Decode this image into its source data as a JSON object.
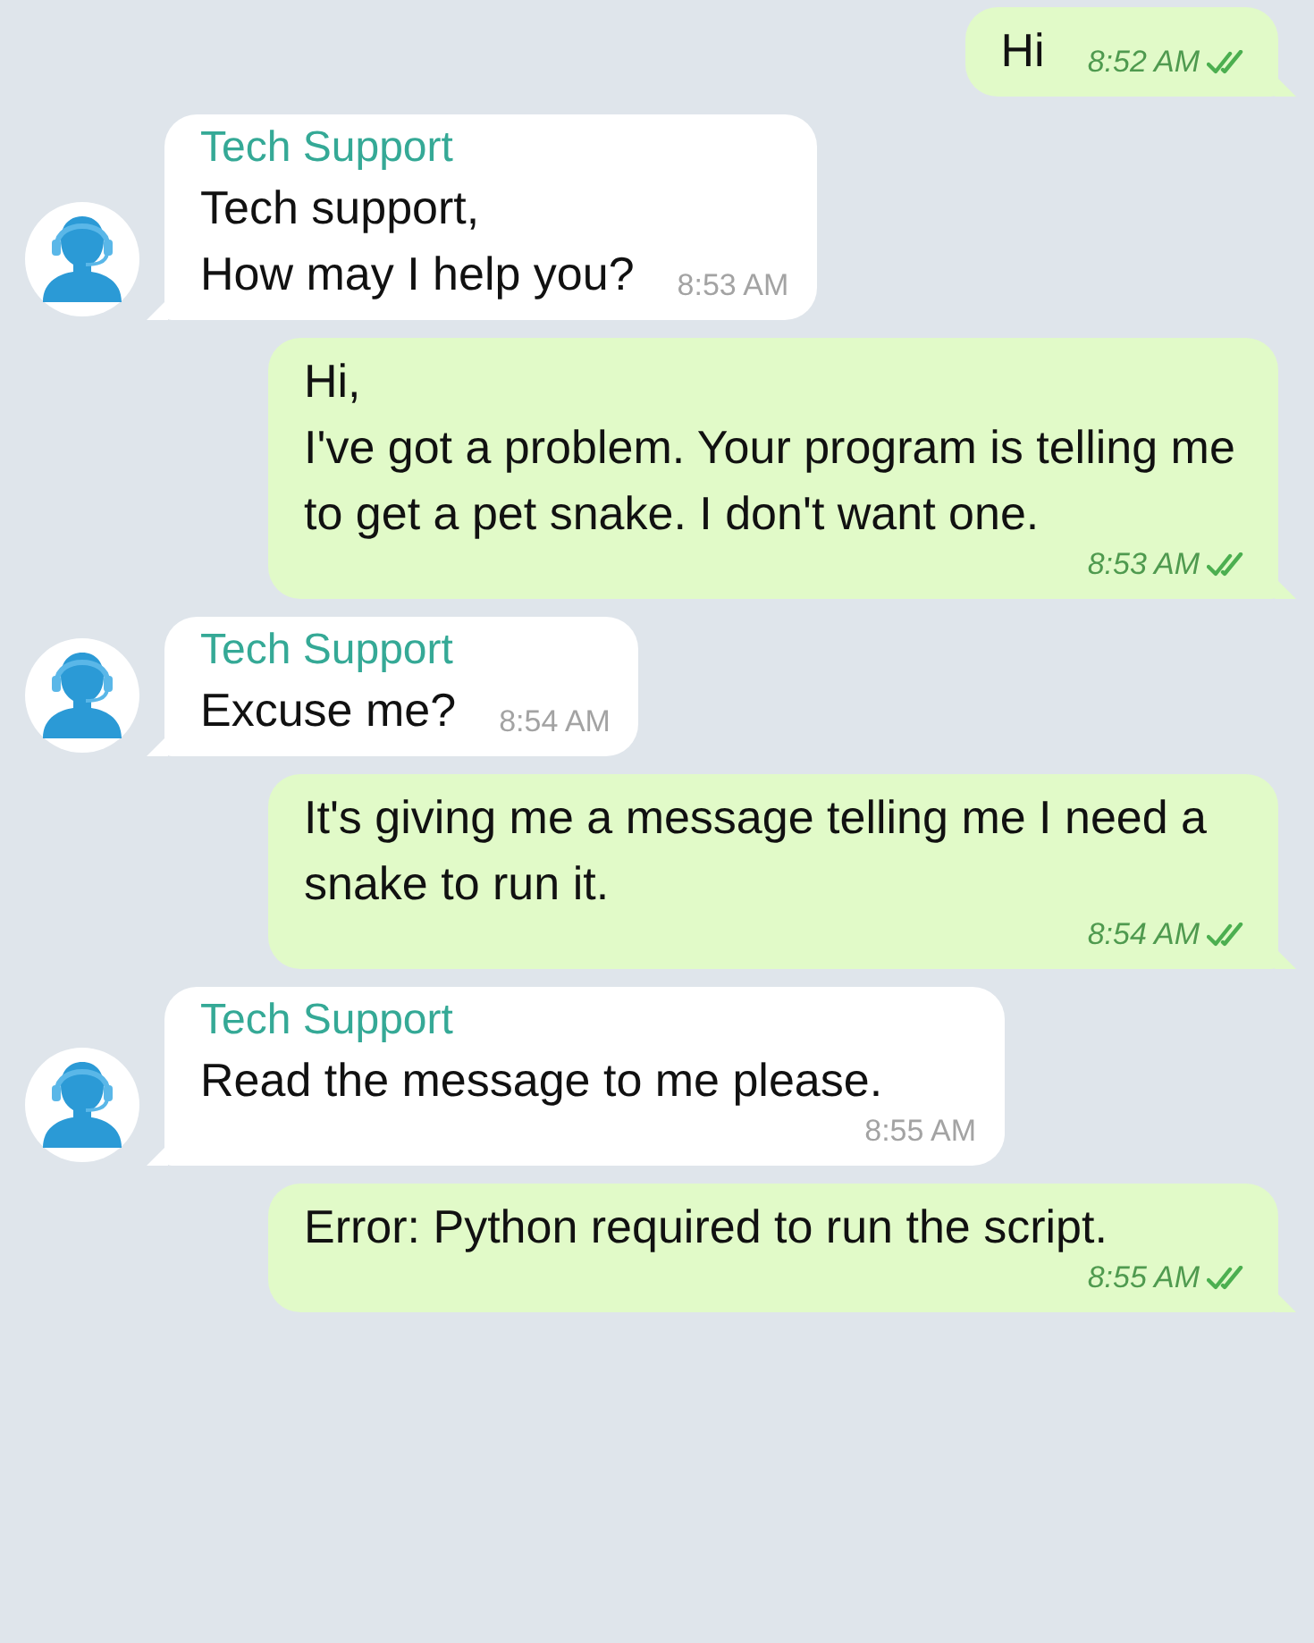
{
  "messages": [
    {
      "kind": "outgoing",
      "text": "Hi",
      "time": "8:52 AM"
    },
    {
      "kind": "incoming",
      "sender": "Tech Support",
      "text": "Tech support,\nHow may I help you?",
      "time": "8:53 AM"
    },
    {
      "kind": "outgoing",
      "text": "Hi,\nI've got a problem. Your program is telling me to get a pet snake. I don't want one.",
      "time": "8:53 AM"
    },
    {
      "kind": "incoming",
      "sender": "Tech Support",
      "text": "Excuse me?",
      "time": "8:54 AM"
    },
    {
      "kind": "outgoing",
      "text": "It's giving me a message telling me I need a snake to run it.",
      "time": "8:54 AM"
    },
    {
      "kind": "incoming",
      "sender": "Tech Support",
      "text": "Read the message to me please.",
      "time": "8:55 AM"
    },
    {
      "kind": "outgoing",
      "text": "Error: Python required to run the script.",
      "time": "8:55 AM"
    }
  ]
}
